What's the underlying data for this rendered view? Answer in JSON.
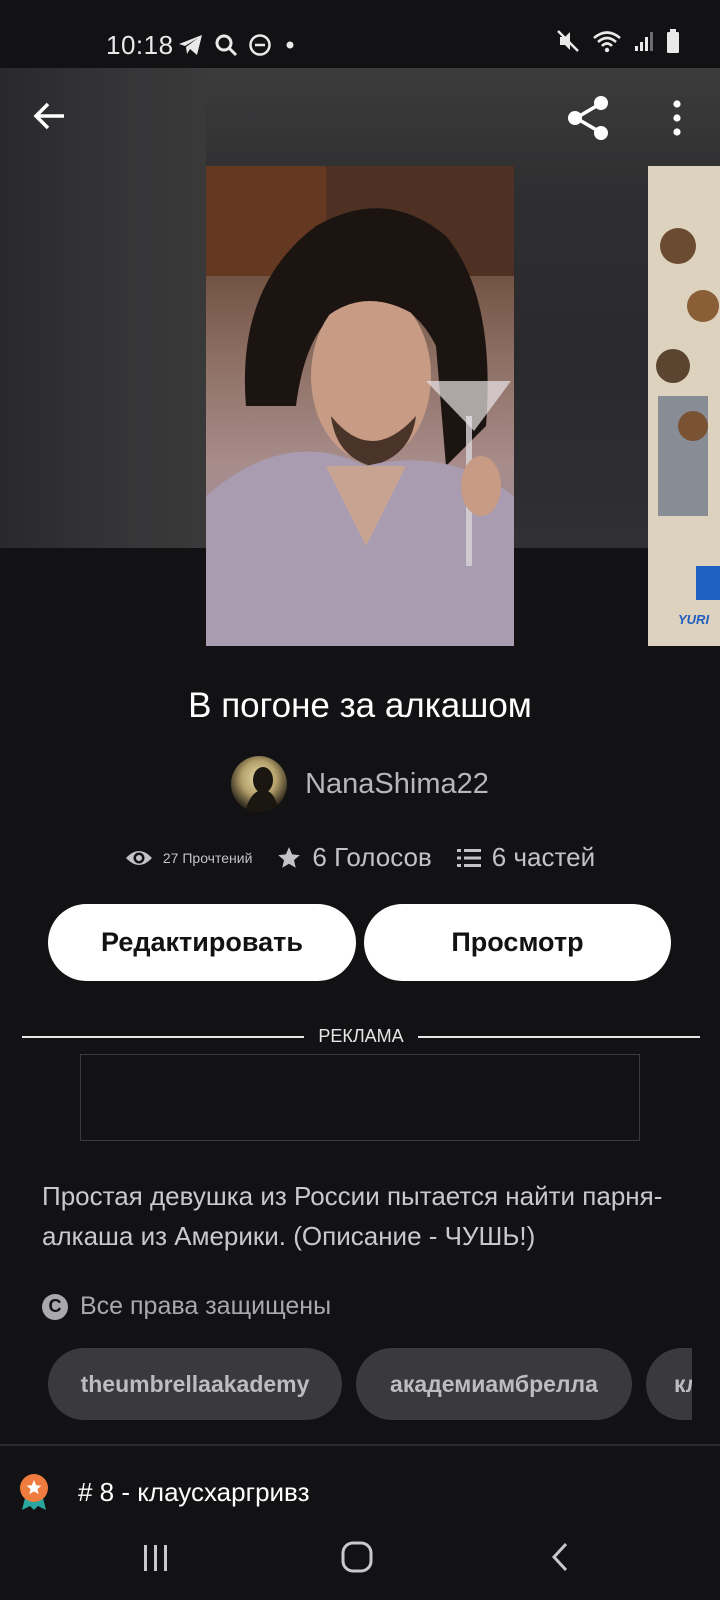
{
  "status_bar": {
    "time": "10:18",
    "left_icons": [
      "telegram-icon",
      "search-icon",
      "do-not-disturb-icon",
      "dot-icon"
    ],
    "right_icons": [
      "mute-vibrate-icon",
      "wifi-icon",
      "signal-icon",
      "battery-icon"
    ]
  },
  "toolbar": {
    "back_icon": "arrow-left-icon",
    "share_icon": "share-icon",
    "more_icon": "more-vertical-icon"
  },
  "story": {
    "title": "В погоне за алкашом",
    "author": "NanaShima22",
    "next_cover_caption": "YURI"
  },
  "stats": {
    "reads": "27 Прочтений",
    "votes": "6 Голосов",
    "parts": "6 частей"
  },
  "actions": {
    "edit_label": "Редактировать",
    "view_label": "Просмотр"
  },
  "ad": {
    "label": "РЕКЛАМА"
  },
  "description": "Простая девушка из России пытается найти парня-алкаша из Америки. (Описание - ЧУШЬ!)",
  "copyright": {
    "icon_glyph": "C",
    "text": "Все права защищены"
  },
  "tags": [
    "theumbrellaakademy",
    "академиамбрелла",
    "кл"
  ],
  "ranking": {
    "text": "# 8 - клаусхаргривз"
  },
  "colors": {
    "background": "#121113",
    "button_bg": "#ffffff",
    "tag_bg": "#3a393c",
    "badge_orange": "#f07b3f",
    "badge_teal": "#2aa6a0"
  }
}
